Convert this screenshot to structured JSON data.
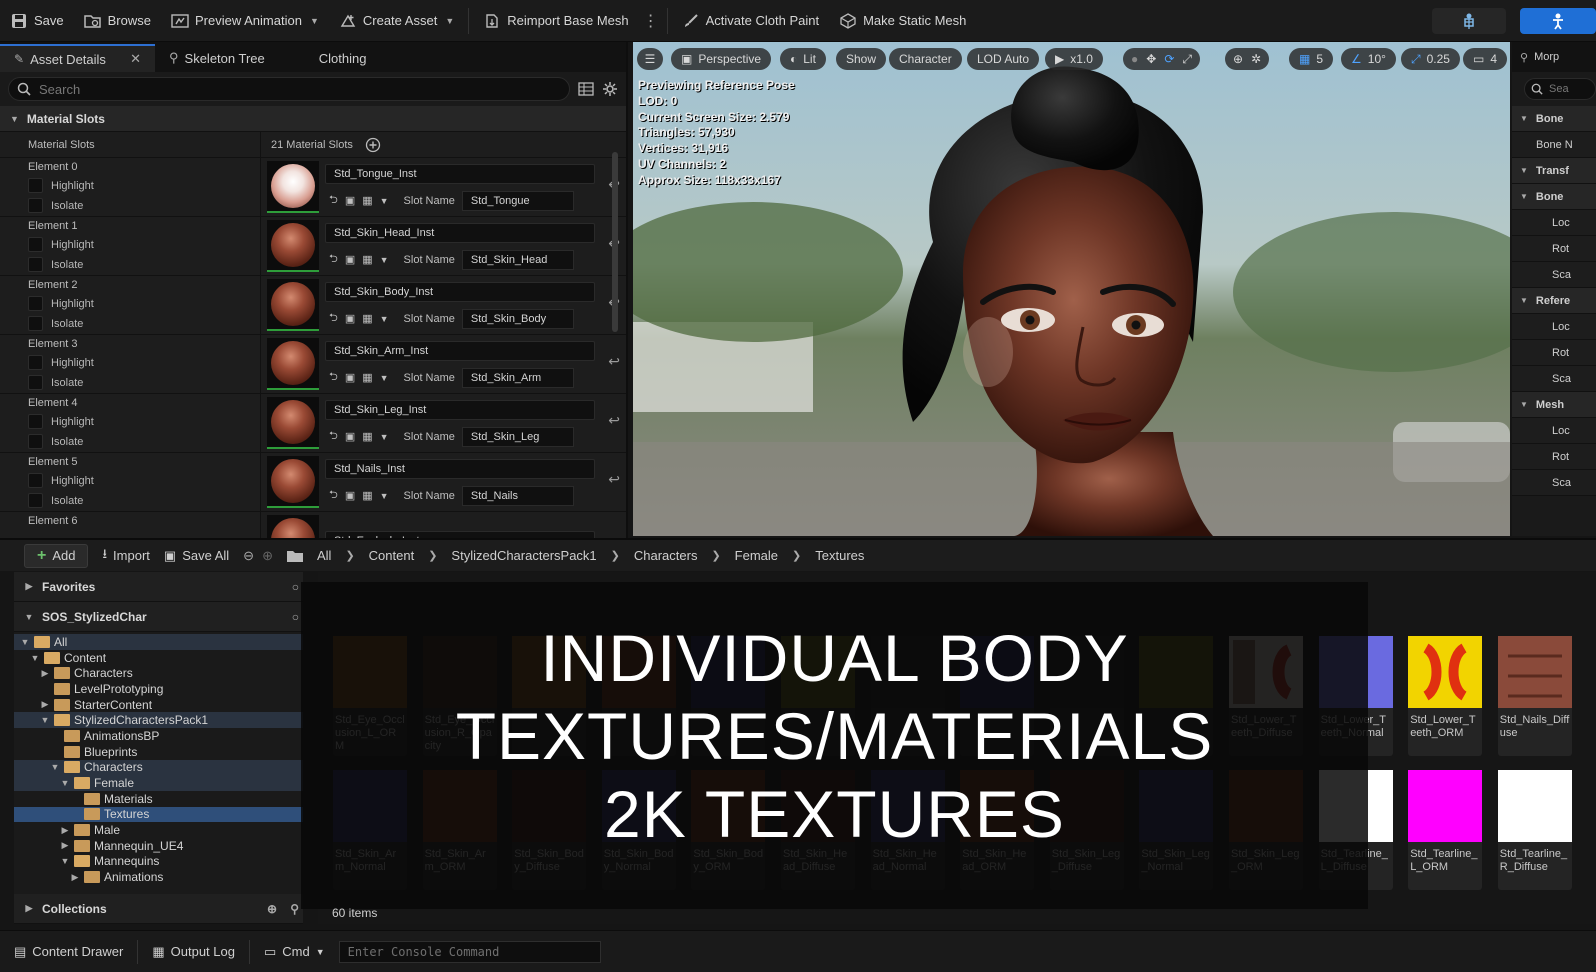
{
  "toolbar": {
    "save": "Save",
    "browse": "Browse",
    "preview_animation": "Preview Animation",
    "create_asset": "Create Asset",
    "reimport": "Reimport Base Mesh",
    "activate_cloth": "Activate Cloth Paint",
    "make_static": "Make Static Mesh"
  },
  "details": {
    "tabs": [
      "Asset Details",
      "Skeleton Tree",
      "Clothing"
    ],
    "search_placeholder": "Search",
    "section": "Material Slots",
    "slots_label": "Material Slots",
    "slots_count": "21 Material Slots",
    "highlight_label": "Highlight",
    "isolate_label": "Isolate",
    "slot_name_label": "Slot Name",
    "elements": [
      {
        "label": "Element 0",
        "material": "Std_Tongue_Inst",
        "slot": "Std_Tongue"
      },
      {
        "label": "Element 1",
        "material": "Std_Skin_Head_Inst",
        "slot": "Std_Skin_Head"
      },
      {
        "label": "Element 2",
        "material": "Std_Skin_Body_Inst",
        "slot": "Std_Skin_Body"
      },
      {
        "label": "Element 3",
        "material": "Std_Skin_Arm_Inst",
        "slot": "Std_Skin_Arm"
      },
      {
        "label": "Element 4",
        "material": "Std_Skin_Leg_Inst",
        "slot": "Std_Skin_Leg"
      },
      {
        "label": "Element 5",
        "material": "Std_Nails_Inst",
        "slot": "Std_Nails"
      },
      {
        "label": "Element 6",
        "material": "Std_Eyelash_Inst",
        "slot": ""
      }
    ]
  },
  "viewport": {
    "perspective": "Perspective",
    "lit": "Lit",
    "show": "Show",
    "character": "Character",
    "lod": "LOD Auto",
    "speed": "x1.0",
    "grid_value": "5",
    "angle_value": "10°",
    "scale_value": "0.25",
    "camera_value": "4",
    "stats": [
      "Previewing Reference Pose",
      "LOD: 0",
      "Current Screen Size: 2.579",
      "Triangles: 57,930",
      "Vertices: 31,916",
      "UV Channels: 2",
      "Approx Size: 118x33x167"
    ]
  },
  "right_panel": {
    "tab": "Morp",
    "search": "Sea",
    "rows": [
      "Bone",
      "Bone N",
      "Transf",
      "Bone",
      "Loc",
      "Rot",
      "Sca",
      "Refere",
      "Loc",
      "Rot",
      "Sca",
      "Mesh",
      "Loc",
      "Rot",
      "Sca"
    ]
  },
  "content_browser": {
    "add": "Add",
    "import": "Import",
    "save_all": "Save All",
    "breadcrumb": [
      "All",
      "Content",
      "StylizedCharactersPack1",
      "Characters",
      "Female",
      "Textures"
    ],
    "favorites": "Favorites",
    "project": "SOS_StylizedChar",
    "collections": "Collections",
    "tree": [
      {
        "label": "All",
        "depth": 0,
        "open": true
      },
      {
        "label": "Content",
        "depth": 1,
        "open": true
      },
      {
        "label": "Characters",
        "depth": 2,
        "open": false
      },
      {
        "label": "LevelPrototyping",
        "depth": 2,
        "open": false
      },
      {
        "label": "StarterContent",
        "depth": 2,
        "open": false
      },
      {
        "label": "StylizedCharactersPack1",
        "depth": 2,
        "open": true
      },
      {
        "label": "AnimationsBP",
        "depth": 3,
        "open": false
      },
      {
        "label": "Blueprints",
        "depth": 3,
        "open": false
      },
      {
        "label": "Characters",
        "depth": 3,
        "open": true
      },
      {
        "label": "Female",
        "depth": 4,
        "open": true
      },
      {
        "label": "Materials",
        "depth": 5,
        "open": false
      },
      {
        "label": "Textures",
        "depth": 5,
        "open": false
      },
      {
        "label": "Male",
        "depth": 4,
        "open": false
      },
      {
        "label": "Mannequin_UE4",
        "depth": 4,
        "open": false
      },
      {
        "label": "Mannequins",
        "depth": 4,
        "open": true
      },
      {
        "label": "Animations",
        "depth": 5,
        "open": false
      }
    ],
    "assets_row1": [
      {
        "name": "Std_Eye_Occlusion_L_ORM",
        "color": "#7a4a12"
      },
      {
        "name": "Std_Eye_Occlusion_R_Opacity",
        "color": "#3c2618"
      },
      {
        "name": "",
        "color": "#7a4a12"
      },
      {
        "name": "",
        "color": "#6a2a12"
      },
      {
        "name": "",
        "color": "#24245a"
      },
      {
        "name": "",
        "color": "#5a5a10"
      },
      {
        "name": "",
        "color": "#222"
      },
      {
        "name": "",
        "color": "#24245a"
      },
      {
        "name": "",
        "color": "#222"
      },
      {
        "name": "",
        "color": "#5a5a10"
      },
      {
        "name": "Std_Lower_Teeth_Diffuse",
        "color": "#8a6b5a"
      },
      {
        "name": "Std_Lower_Teeth_Normal",
        "color": "#6a6ae0"
      },
      {
        "name": "Std_Lower_Teeth_ORM",
        "color": "#f2d400"
      },
      {
        "name": "Std_Nails_Diffuse",
        "color": "#8a4a3a"
      }
    ],
    "assets_row2": [
      {
        "name": "Std_Skin_Arm_Normal",
        "color": "#2a2a6a"
      },
      {
        "name": "Std_Skin_Arm_ORM",
        "color": "#6a2a10"
      },
      {
        "name": "Std_Skin_Body_Diffuse",
        "color": "#3a1a10"
      },
      {
        "name": "Std_Skin_Body_Normal",
        "color": "#2a2a6a"
      },
      {
        "name": "Std_Skin_Body_ORM",
        "color": "#6a2a10"
      },
      {
        "name": "Std_Skin_Head_Diffuse",
        "color": "#3a1a10"
      },
      {
        "name": "Std_Skin_Head_Normal",
        "color": "#2a2a6a"
      },
      {
        "name": "Std_Skin_Head_ORM",
        "color": "#6a2a10"
      },
      {
        "name": "Std_Skin_Leg_Diffuse",
        "color": "#3a1a10"
      },
      {
        "name": "Std_Skin_Leg_Normal",
        "color": "#2a2a6a"
      },
      {
        "name": "Std_Skin_Leg_ORM",
        "color": "#6a2a10"
      },
      {
        "name": "Std_Tearline_L_Diffuse",
        "color": "#ffffff"
      },
      {
        "name": "Std_Tearline_L_ORM",
        "color": "#ff00ff"
      },
      {
        "name": "Std_Tearline_R_Diffuse",
        "color": "#ffffff"
      }
    ],
    "item_count": "60 items"
  },
  "overlay": {
    "line1": "INDIVIDUAL BODY",
    "line2": "TEXTURES/MATERIALS",
    "line3": "2K TEXTURES"
  },
  "status": {
    "content_drawer": "Content Drawer",
    "output_log": "Output Log",
    "cmd": "Cmd",
    "console_placeholder": "Enter Console Command"
  }
}
